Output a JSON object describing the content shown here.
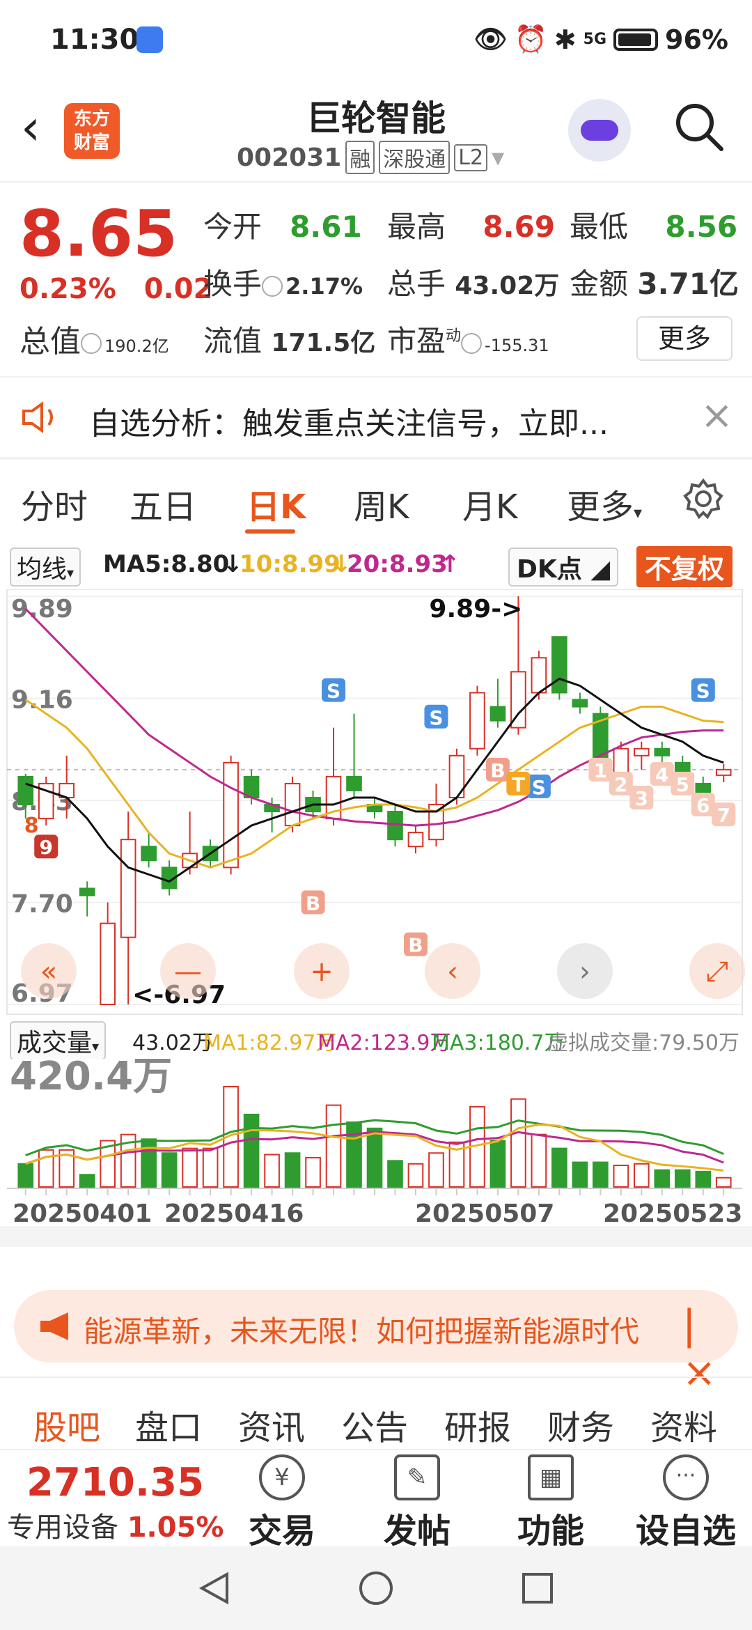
{
  "status": {
    "time": "11:30",
    "battery": "96%",
    "network": "5G"
  },
  "header": {
    "logo_line1": "东方",
    "logo_line2": "财富",
    "stock_name": "巨轮智能",
    "stock_code": "002031",
    "tag_rong": "融",
    "tag_sgt": "深股通",
    "tag_l2": "L2"
  },
  "quote": {
    "price": "8.65",
    "change_pct": "0.23%",
    "change_amt": "0.02",
    "total_value_label": "总值",
    "total_value": "190.2亿",
    "open_label": "今开",
    "open": "8.61",
    "high_label": "最高",
    "high": "8.69",
    "low_label": "最低",
    "low": "8.56",
    "turnover_label": "换手",
    "turnover": "2.17%",
    "volume_label": "总手",
    "volume": "43.02万",
    "amount_label": "金额",
    "amount": "3.71亿",
    "float_label": "流值",
    "float_value": "171.5亿",
    "pe_label": "市盈",
    "pe_sup": "动",
    "pe": "-155.31",
    "more_button": "更多"
  },
  "alert": {
    "text": "自选分析：触发重点关注信号，立即..."
  },
  "period_tabs": [
    "分时",
    "五日",
    "日K",
    "周K",
    "月K",
    "更多"
  ],
  "ma_row": {
    "selector": "均线",
    "ma5": "MA5:8.80",
    "ma10": "10:8.99",
    "ma20": "20:8.93",
    "dk": "DK点",
    "fq": "不复权"
  },
  "chart_labels": {
    "high_mark": "9.89->",
    "low_mark": "<-6.97",
    "y_ticks": [
      "9.89",
      "9.16",
      "8.43",
      "7.70",
      "6.97"
    ],
    "vol_max": "420.4万",
    "dates": [
      "20250401",
      "20250416",
      "20250507",
      "20250523"
    ]
  },
  "vol_row": {
    "selector": "成交量",
    "vol": "43.02万",
    "ma1": "MA1:82.97万",
    "ma2": "MA2:123.9万",
    "ma3": "MA3:180.7万",
    "virtual": "虚拟成交量:79.50万"
  },
  "chart_data": {
    "type": "candlestick",
    "ylim": [
      6.97,
      9.89
    ],
    "y_ticks": [
      9.89,
      9.16,
      8.43,
      7.7,
      6.97
    ],
    "x_dates": [
      "20250401",
      "20250416",
      "20250507",
      "20250523"
    ],
    "candles": [
      {
        "o": 8.6,
        "c": 8.4,
        "h": 8.62,
        "l": 8.3
      },
      {
        "o": 8.3,
        "c": 8.55,
        "h": 8.6,
        "l": 8.25
      },
      {
        "o": 8.45,
        "c": 8.55,
        "h": 8.75,
        "l": 8.3
      },
      {
        "o": 7.8,
        "c": 7.75,
        "h": 7.85,
        "l": 7.6
      },
      {
        "o": 6.97,
        "c": 7.55,
        "h": 7.7,
        "l": 6.97
      },
      {
        "o": 7.45,
        "c": 8.15,
        "h": 8.35,
        "l": 6.97
      },
      {
        "o": 8.1,
        "c": 8.0,
        "h": 8.2,
        "l": 7.95
      },
      {
        "o": 7.95,
        "c": 7.8,
        "h": 8.0,
        "l": 7.75
      },
      {
        "o": 7.95,
        "c": 8.05,
        "h": 8.35,
        "l": 7.9
      },
      {
        "o": 8.1,
        "c": 8.0,
        "h": 8.15,
        "l": 7.95
      },
      {
        "o": 7.95,
        "c": 8.7,
        "h": 8.75,
        "l": 7.9
      },
      {
        "o": 8.6,
        "c": 8.45,
        "h": 8.65,
        "l": 8.4
      },
      {
        "o": 8.4,
        "c": 8.35,
        "h": 8.45,
        "l": 8.2
      },
      {
        "o": 8.25,
        "c": 8.55,
        "h": 8.6,
        "l": 8.2
      },
      {
        "o": 8.45,
        "c": 8.35,
        "h": 8.5,
        "l": 8.3
      },
      {
        "o": 8.3,
        "c": 8.6,
        "h": 8.95,
        "l": 8.25
      },
      {
        "o": 8.6,
        "c": 8.5,
        "h": 9.05,
        "l": 8.45
      },
      {
        "o": 8.4,
        "c": 8.35,
        "h": 8.45,
        "l": 8.3
      },
      {
        "o": 8.35,
        "c": 8.15,
        "h": 8.4,
        "l": 8.1
      },
      {
        "o": 8.1,
        "c": 8.2,
        "h": 8.25,
        "l": 8.05
      },
      {
        "o": 8.15,
        "c": 8.4,
        "h": 8.55,
        "l": 8.1
      },
      {
        "o": 8.45,
        "c": 8.75,
        "h": 8.8,
        "l": 8.4
      },
      {
        "o": 8.8,
        "c": 9.2,
        "h": 9.25,
        "l": 8.75
      },
      {
        "o": 9.1,
        "c": 9.0,
        "h": 9.3,
        "l": 8.95
      },
      {
        "o": 8.95,
        "c": 9.35,
        "h": 9.89,
        "l": 8.9
      },
      {
        "o": 9.2,
        "c": 9.45,
        "h": 9.5,
        "l": 9.15
      },
      {
        "o": 9.6,
        "c": 9.2,
        "h": 9.6,
        "l": 9.15
      },
      {
        "o": 9.15,
        "c": 9.1,
        "h": 9.2,
        "l": 9.05
      },
      {
        "o": 9.05,
        "c": 8.7,
        "h": 9.1,
        "l": 8.65
      },
      {
        "o": 8.6,
        "c": 8.8,
        "h": 8.85,
        "l": 8.55
      },
      {
        "o": 8.75,
        "c": 8.8,
        "h": 8.85,
        "l": 8.65
      },
      {
        "o": 8.8,
        "c": 8.75,
        "h": 8.85,
        "l": 8.7
      },
      {
        "o": 8.7,
        "c": 8.55,
        "h": 8.75,
        "l": 8.5
      },
      {
        "o": 8.55,
        "c": 8.45,
        "h": 8.6,
        "l": 8.4
      },
      {
        "o": 8.61,
        "c": 8.65,
        "h": 8.69,
        "l": 8.56
      }
    ],
    "ma5": [
      8.55,
      8.5,
      8.45,
      8.3,
      8.1,
      7.95,
      7.9,
      7.85,
      7.95,
      8.05,
      8.15,
      8.25,
      8.3,
      8.35,
      8.4,
      8.4,
      8.45,
      8.45,
      8.4,
      8.35,
      8.35,
      8.45,
      8.65,
      8.85,
      9.05,
      9.2,
      9.3,
      9.25,
      9.15,
      9.05,
      8.95,
      8.9,
      8.85,
      8.75,
      8.7
    ],
    "ma10": [
      9.15,
      9.05,
      8.95,
      8.8,
      8.6,
      8.4,
      8.2,
      8.05,
      8.0,
      7.95,
      8.0,
      8.05,
      8.15,
      8.25,
      8.3,
      8.35,
      8.38,
      8.4,
      8.4,
      8.38,
      8.35,
      8.38,
      8.45,
      8.55,
      8.65,
      8.75,
      8.85,
      8.95,
      9.0,
      9.05,
      9.1,
      9.1,
      9.05,
      9.0,
      8.99
    ],
    "ma20": [
      9.8,
      9.65,
      9.5,
      9.35,
      9.2,
      9.05,
      8.9,
      8.8,
      8.7,
      8.6,
      8.52,
      8.45,
      8.4,
      8.35,
      8.32,
      8.3,
      8.28,
      8.27,
      8.26,
      8.25,
      8.26,
      8.28,
      8.32,
      8.36,
      8.42,
      8.5,
      8.6,
      8.68,
      8.75,
      8.82,
      8.88,
      8.9,
      8.92,
      8.93,
      8.93
    ],
    "volume": {
      "max": "420.4万",
      "up": [
        false,
        true,
        true,
        false,
        true,
        true,
        false,
        false,
        true,
        true,
        true,
        false,
        true,
        false,
        true,
        true,
        false,
        false,
        false,
        true,
        true,
        true,
        true,
        false,
        true,
        true,
        false,
        false,
        false,
        true,
        true,
        false,
        false,
        false,
        true
      ],
      "values": [
        150,
        240,
        240,
        80,
        300,
        340,
        310,
        220,
        250,
        250,
        650,
        470,
        210,
        220,
        190,
        530,
        420,
        380,
        170,
        150,
        220,
        290,
        520,
        300,
        570,
        340,
        250,
        160,
        160,
        140,
        150,
        110,
        110,
        100,
        60
      ]
    },
    "annotations": [
      "S",
      "B",
      "T",
      "1",
      "2",
      "3",
      "4",
      "5",
      "6",
      "7",
      "8",
      "9"
    ]
  },
  "banner": {
    "text": "能源革新，未来无限！如何把握新能源时代"
  },
  "bottom_tabs": [
    "股吧",
    "盘口",
    "资讯",
    "公告",
    "研报",
    "财务",
    "资料"
  ],
  "bottom_bar": {
    "index_value": "2710.35",
    "index_name": "专用设备",
    "index_change": "1.05%",
    "actions": [
      "交易",
      "发帖",
      "功能",
      "设自选"
    ]
  }
}
